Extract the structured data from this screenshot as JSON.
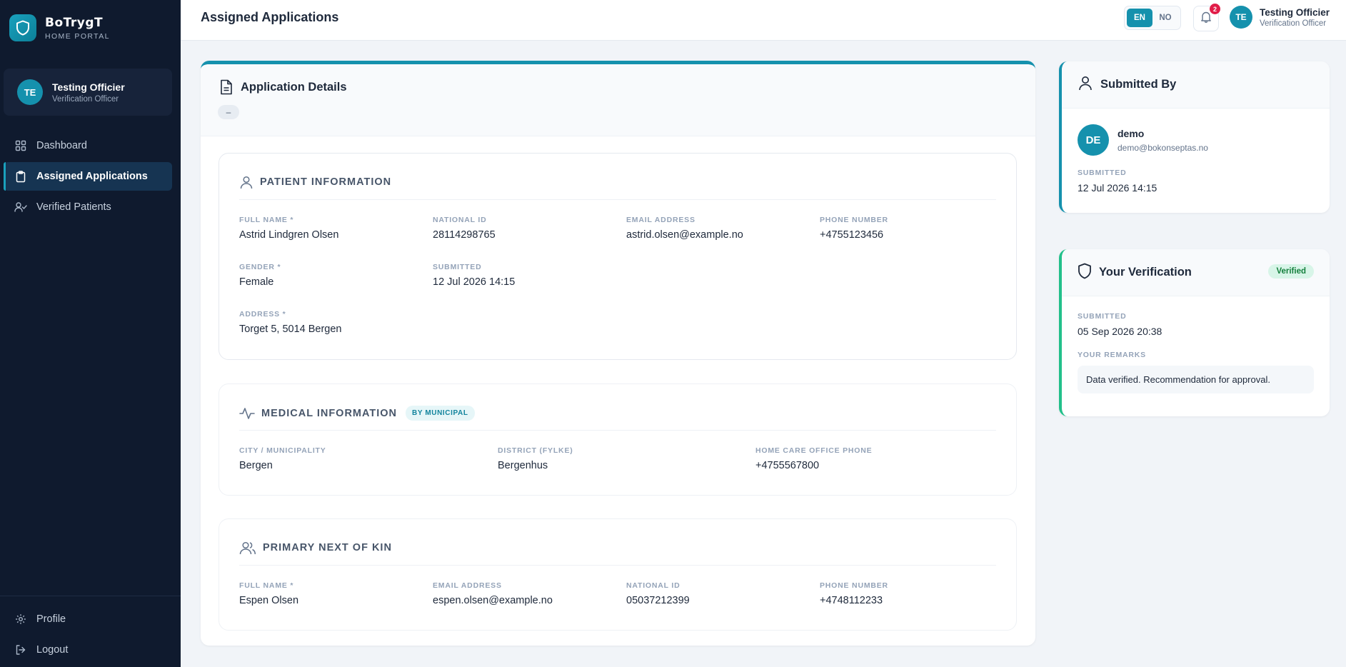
{
  "brand": {
    "name": "BoTrygT",
    "subtitle": "HOME PORTAL"
  },
  "user": {
    "initials": "TE",
    "name": "Testing Officier",
    "role": "Verification Officer"
  },
  "nav": {
    "items": [
      {
        "label": "Dashboard",
        "icon": "grid-icon"
      },
      {
        "label": "Assigned Applications",
        "icon": "clipboard-icon",
        "active": true
      },
      {
        "label": "Verified Patients",
        "icon": "user-check-icon"
      }
    ],
    "bottom": [
      {
        "label": "Profile",
        "icon": "gear-icon"
      },
      {
        "label": "Logout",
        "icon": "logout-icon"
      }
    ]
  },
  "header": {
    "title": "Assigned Applications",
    "lang": {
      "en": "EN",
      "no": "NO",
      "active": "EN"
    },
    "notifications_count": "2"
  },
  "application": {
    "title": "Application Details",
    "status_pill": "–",
    "patient": {
      "title": "PATIENT INFORMATION",
      "full_name_label": "FULL NAME *",
      "full_name": "Astrid Lindgren Olsen",
      "national_id_label": "NATIONAL ID",
      "national_id": "28114298765",
      "email_label": "EMAIL ADDRESS",
      "email": "astrid.olsen@example.no",
      "phone_label": "PHONE NUMBER",
      "phone": "+4755123456",
      "gender_label": "GENDER *",
      "gender": "Female",
      "submitted_label": "SUBMITTED",
      "submitted": "12 Jul 2026 14:15",
      "address_label": "ADDRESS *",
      "address": "Torget 5, 5014 Bergen"
    },
    "medical": {
      "title": "MEDICAL INFORMATION",
      "tag": "BY MUNICIPAL",
      "city_label": "CITY / MUNICIPALITY",
      "city": "Bergen",
      "district_label": "DISTRICT (FYLKE)",
      "district": "Bergenhus",
      "office_phone_label": "HOME CARE OFFICE PHONE",
      "office_phone": "+4755567800"
    },
    "kin": {
      "title": "PRIMARY NEXT OF KIN",
      "full_name_label": "FULL NAME *",
      "full_name": "Espen Olsen",
      "email_label": "EMAIL ADDRESS",
      "email": "espen.olsen@example.no",
      "national_id_label": "NATIONAL ID",
      "national_id": "05037212399",
      "phone_label": "PHONE NUMBER",
      "phone": "+4748112233"
    }
  },
  "submitted_by": {
    "title": "Submitted By",
    "initials": "DE",
    "name": "demo",
    "email": "demo@bokonseptas.no",
    "submitted_label": "SUBMITTED",
    "submitted": "12 Jul 2026 14:15"
  },
  "verification": {
    "title": "Your Verification",
    "badge": "Verified",
    "submitted_label": "SUBMITTED",
    "submitted": "05 Sep 2026 20:38",
    "remarks_label": "YOUR REMARKS",
    "remarks": "Data verified. Recommendation for approval."
  },
  "colors": {
    "accent": "#1591ad",
    "sidebar": "#0f1a2e",
    "verified": "#22c08a",
    "badge": "#e11d48"
  }
}
